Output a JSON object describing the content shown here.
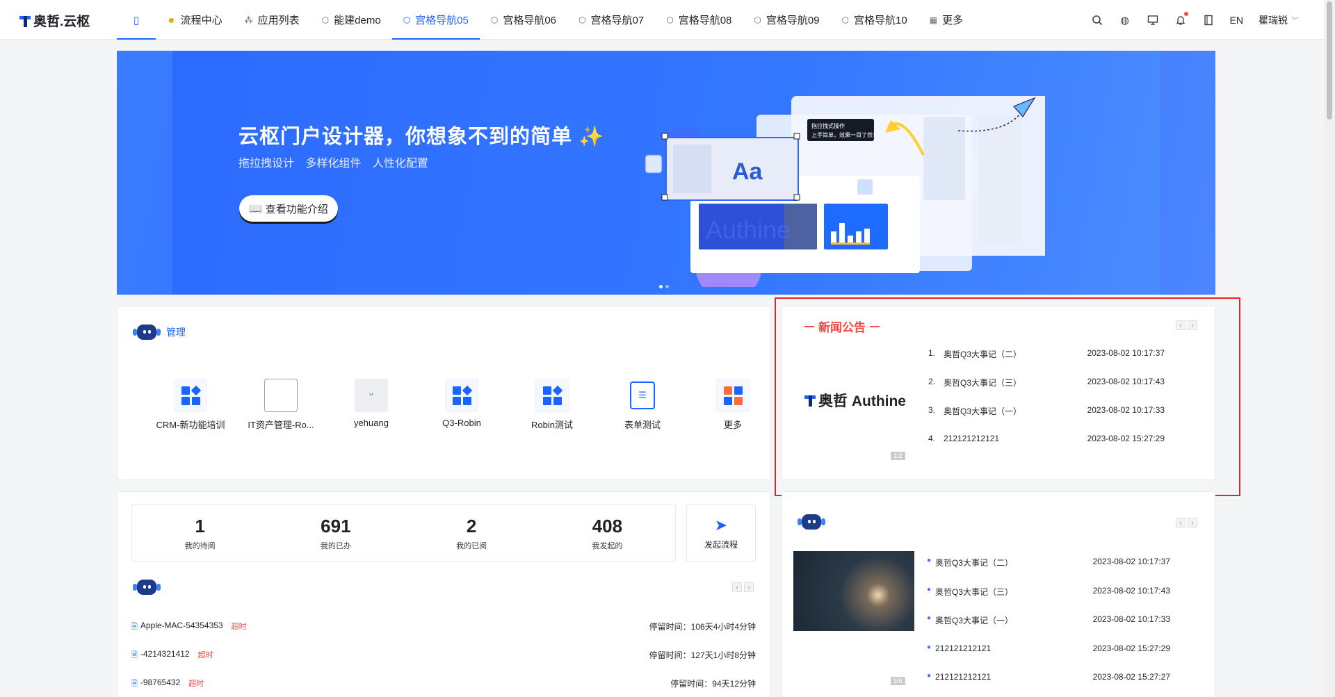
{
  "header": {
    "logo_text": "奥哲.云枢",
    "nav": [
      {
        "label": "",
        "icon": "page-icon"
      },
      {
        "label": "流程中心",
        "icon": "emoji-icon"
      },
      {
        "label": "应用列表",
        "icon": "grid-icon"
      },
      {
        "label": "能建demo",
        "icon": "cube-icon"
      },
      {
        "label": "宫格导航05",
        "icon": "cube-icon"
      },
      {
        "label": "宫格导航06",
        "icon": "cube-icon"
      },
      {
        "label": "宫格导航07",
        "icon": "cube-icon"
      },
      {
        "label": "宫格导航08",
        "icon": "cube-icon"
      },
      {
        "label": "宫格导航09",
        "icon": "cube-icon"
      },
      {
        "label": "宫格导航10",
        "icon": "cube-icon"
      },
      {
        "label": "更多",
        "icon": "apps-icon"
      }
    ],
    "language": "EN",
    "user": "瞿瑞锐"
  },
  "banner": {
    "title": "云枢门户设计器，你想象不到的简单",
    "subtitle": "拖拉拽设计 多样化组件 人性化配置",
    "button": "查看功能介绍",
    "tooltip_line1": "拖拉拽式操作",
    "tooltip_line2": "上手简单，效果一目了然！",
    "sample_text": "Aa",
    "watermark": "Authine"
  },
  "apps": {
    "title": "管理",
    "items": [
      {
        "label": "CRM-新功能培训",
        "icon": "grid"
      },
      {
        "label": "IT资产管理-Ro...",
        "icon": "broken"
      },
      {
        "label": "yehuang",
        "icon": "avatar"
      },
      {
        "label": "Q3-Robin",
        "icon": "grid"
      },
      {
        "label": "Robin测试",
        "icon": "grid"
      },
      {
        "label": "表单测试",
        "icon": "form"
      },
      {
        "label": "更多",
        "icon": "more"
      }
    ]
  },
  "news": {
    "title": "新闻公告",
    "logo_text": "奥哲 Authine",
    "page": "1/2",
    "items": [
      {
        "no": "1.",
        "title": "奥哲Q3大事记（二）",
        "date": "2023-08-02 10:17:37"
      },
      {
        "no": "2.",
        "title": "奥哲Q3大事记（三）",
        "date": "2023-08-02 10:17:43"
      },
      {
        "no": "3.",
        "title": "奥哲Q3大事记（一）",
        "date": "2023-08-02 10:17:33"
      },
      {
        "no": "4.",
        "title": "212121212121",
        "date": "2023-08-02 15:27:29"
      }
    ]
  },
  "stats": {
    "items": [
      {
        "value": "1",
        "label": "我的待阅"
      },
      {
        "value": "691",
        "label": "我的已办"
      },
      {
        "value": "2",
        "label": "我的已阅"
      },
      {
        "value": "408",
        "label": "我发起的"
      }
    ],
    "launch": "发起流程"
  },
  "todo": {
    "items": [
      {
        "title": "Apple-MAC-54354353",
        "tag": "超时",
        "stay": "停留时间：106天4小时4分钟"
      },
      {
        "title": "-4214321412",
        "tag": "超时",
        "stay": "停留时间：127天1小时8分钟"
      },
      {
        "title": "-98765432",
        "tag": "超时",
        "stay": "停留时间：94天12分钟"
      }
    ]
  },
  "feed": {
    "page": "3/6",
    "items": [
      {
        "title": "奥哲Q3大事记（二）",
        "date": "2023-08-02 10:17:37"
      },
      {
        "title": "奥哲Q3大事记（三）",
        "date": "2023-08-02 10:17:43"
      },
      {
        "title": "奥哲Q3大事记（一）",
        "date": "2023-08-02 10:17:33"
      },
      {
        "title": "212121212121",
        "date": "2023-08-02 15:27:29"
      },
      {
        "title": "212121212121",
        "date": "2023-08-02 15:27:27"
      }
    ]
  },
  "colors": {
    "accent": "#1a64ff",
    "danger": "#f54a45",
    "highlight": "#e0262c"
  }
}
